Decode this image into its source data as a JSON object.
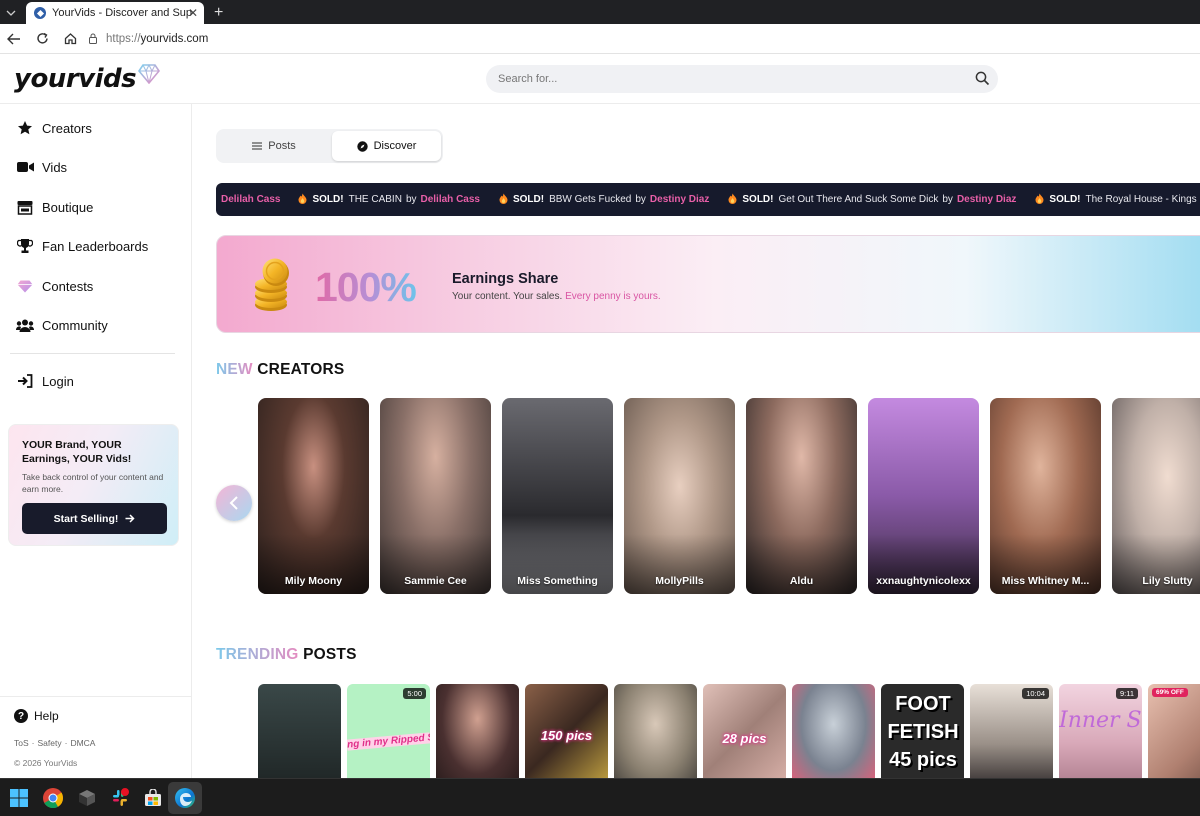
{
  "browser": {
    "tab_title": "YourVids - Discover and Support Your Favorite Creators",
    "url_scheme": "https://",
    "url_host": "yourvids.com"
  },
  "site": {
    "logo": "yourvids",
    "search_placeholder": "Search for..."
  },
  "sidebar": {
    "items": [
      {
        "label": "Creators",
        "icon": "star-icon"
      },
      {
        "label": "Vids",
        "icon": "video-camera-icon"
      },
      {
        "label": "Boutique",
        "icon": "store-icon"
      },
      {
        "label": "Fan Leaderboards",
        "icon": "trophy-icon"
      },
      {
        "label": "Contests",
        "icon": "diamond-icon"
      },
      {
        "label": "Community",
        "icon": "users-icon"
      }
    ],
    "login": "Login",
    "promo": {
      "title": "YOUR Brand, YOUR Earnings, YOUR Vids!",
      "subtitle": "Take back control of your content and earn more.",
      "button": "Start Selling!"
    },
    "help": "Help",
    "legal": [
      "ToS",
      "Safety",
      "DMCA"
    ],
    "copyright": "© 2026 YourVids"
  },
  "main": {
    "tabs": [
      {
        "label": "Posts",
        "active": false
      },
      {
        "label": "Discover",
        "active": true
      }
    ],
    "ticker": {
      "lead_artist": "Delilah Cass",
      "items": [
        {
          "sold": "SOLD!",
          "title": "THE CABIN",
          "by": "by",
          "artist": "Delilah Cass"
        },
        {
          "sold": "SOLD!",
          "title": "BBW Gets Fucked",
          "by": "by",
          "artist": "Destiny Diaz"
        },
        {
          "sold": "SOLD!",
          "title": "Get Out There And Suck Some Dick",
          "by": "by",
          "artist": "Destiny Diaz"
        },
        {
          "sold": "SOLD!",
          "title": "The Royal House - Kings",
          "by": "",
          "artist": ""
        }
      ]
    },
    "banner": {
      "percent": "100%",
      "title": "Earnings Share",
      "subtitle_plain": "Your content. Your sales.",
      "subtitle_highlight": "Every penny is yours."
    },
    "new_creators": {
      "title_highlight": "NEW",
      "title_rest": "CREATORS",
      "creators": [
        {
          "name": "Mily Moony",
          "bg": "#3b2a26"
        },
        {
          "name": "Sammie Cee",
          "bg": "#6b5f5a"
        },
        {
          "name": "Miss Something",
          "bg": "#4a4a4e"
        },
        {
          "name": "MollyPills",
          "bg": "#8a7a6c"
        },
        {
          "name": "Aldu",
          "bg": "#4b3f3a"
        },
        {
          "name": "xxnaughtynicolexx",
          "bg": "#8c6a9a"
        },
        {
          "name": "Miss Whitney M...",
          "bg": "#7a5648"
        },
        {
          "name": "Lily Slutty",
          "bg": "#b8a99e"
        }
      ]
    },
    "trending": {
      "title_highlight": "TRENDING",
      "title_rest": "POSTS",
      "posts": [
        {
          "bg": "#2f3a3a",
          "duration": "",
          "badge": "",
          "overlay": ""
        },
        {
          "bg": "#a8f0b8",
          "duration": "5:00",
          "badge": "",
          "overlay": "ng in my Ripped Sk"
        },
        {
          "bg": "#3a2a2a",
          "duration": "",
          "badge": "",
          "overlay": ""
        },
        {
          "bg": "#6b5040",
          "duration": "",
          "badge": "",
          "overlay": "150 pics"
        },
        {
          "bg": "#a59a88",
          "duration": "",
          "badge": "",
          "overlay": ""
        },
        {
          "bg": "#c9a8a0",
          "duration": "",
          "badge": "",
          "overlay": "28 pics"
        },
        {
          "bg": "#9aa4b0",
          "duration": "",
          "badge": "",
          "overlay": ""
        },
        {
          "bg": "#2a2a2a",
          "duration": "",
          "badge": "",
          "overlay": "FOOT FETISH 45 pics"
        },
        {
          "bg": "#d8d0c8",
          "duration": "10:04",
          "badge": "",
          "overlay": ""
        },
        {
          "bg": "#e7c6d2",
          "duration": "9:11",
          "badge": "",
          "overlay": "Inner Se"
        },
        {
          "bg": "#d8b0a0",
          "duration": "",
          "badge": "69% OFF",
          "overlay": ""
        }
      ]
    }
  }
}
